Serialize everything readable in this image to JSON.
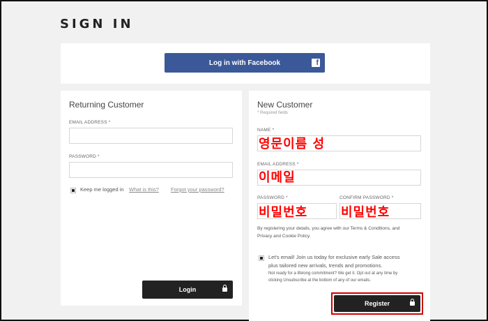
{
  "page": {
    "title": "SIGN IN"
  },
  "facebook": {
    "label": "Log in with Facebook",
    "icon": "facebook-icon",
    "icon_glyph": "f",
    "color": "#3b5998"
  },
  "returning": {
    "title": "Returning Customer",
    "email_label": "EMAIL ADDRESS *",
    "email_value": "",
    "password_label": "PASSWORD *",
    "password_value": "",
    "keep_label": "Keep me logged in",
    "what_label": "What is this?",
    "forgot_label": "Forgot your password?",
    "login_label": "Login"
  },
  "newcust": {
    "title": "New Customer",
    "required_note": "* Required fields",
    "name_label": "NAME *",
    "name_overlay": "영문이름 성",
    "email_label": "EMAIL ADDRESS *",
    "email_overlay": "이메일",
    "password_label": "PASSWORD *",
    "password_overlay": "비밀번호",
    "confirm_label": "CONFIRM PASSWORD *",
    "confirm_overlay": "비밀번호",
    "terms_line1": "By registering your details, you agree with our Terms & Conditions, and",
    "terms_line2": "Privacy and Cookie Policy.",
    "optin_line1": "Let's email! Join us today for exclusive early Sale access",
    "optin_line2": "plus tailored new arrivals, trends and promotions.",
    "optin_line3": "Not ready for a lifelong commitment? We get it. Opt out at any time by",
    "optin_line4": "clicking Unsubscribe at the bottom of any of our emails.",
    "register_label": "Register"
  },
  "colors": {
    "annotation_red": "#ff0000",
    "button_dark": "#222222",
    "highlight_frame": "#d00000"
  }
}
